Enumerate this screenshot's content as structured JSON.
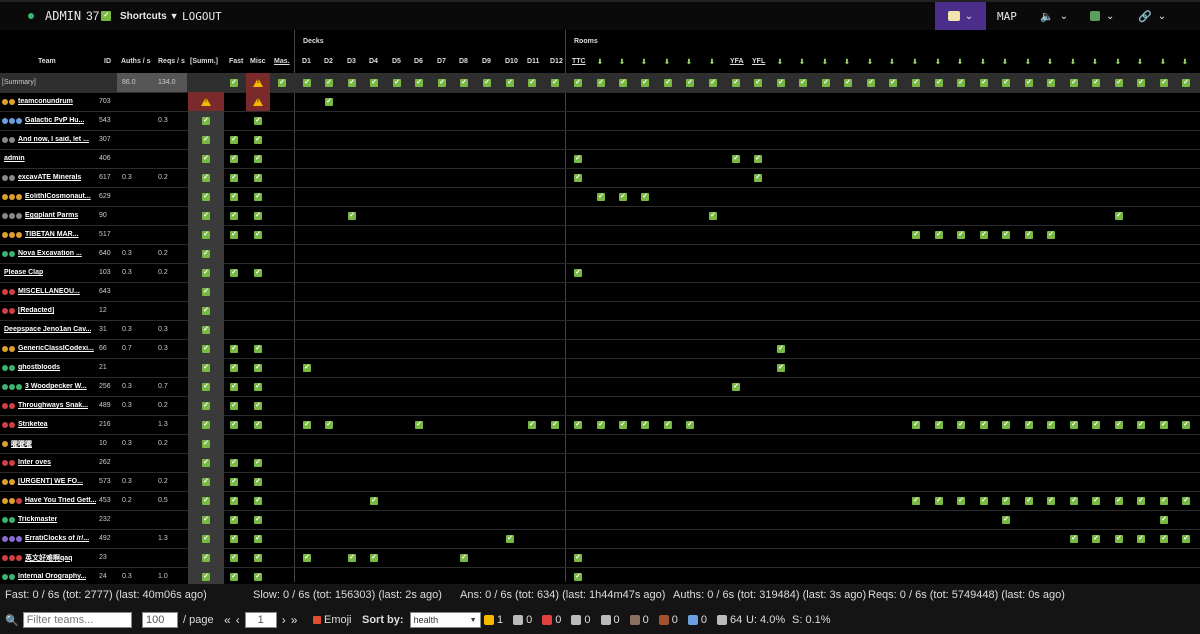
{
  "topbar": {
    "status_icon": "green-dot",
    "admin_label": "ADMIN",
    "count_label": "37",
    "shortcuts_label": "Shortcuts",
    "logout_label": "LOGOUT",
    "map_label": "MAP",
    "accent": "#4a2e8a"
  },
  "table": {
    "team_header": "Team",
    "id_header": "ID",
    "auths_header": "Auths / s",
    "reqs_header": "Reqs / s",
    "summ_header": "[Summ.]",
    "fast_header": "Fast",
    "misc_header": "Misc",
    "mas_header": "Mas.",
    "decks_header": "Decks",
    "rooms_header": "Rooms",
    "decks": [
      "D1",
      "D2",
      "D3",
      "D4",
      "D5",
      "D6",
      "D7",
      "D8",
      "D9",
      "D10",
      "D11",
      "D12"
    ],
    "rooms": [
      "TTC",
      "",
      "",
      "",
      "",
      "",
      "",
      "YFA",
      "YFL",
      "",
      "",
      "",
      "",
      "",
      "",
      "",
      "",
      "",
      "",
      "",
      "",
      "",
      "",
      "",
      "",
      "",
      "",
      ""
    ],
    "summary": {
      "team": "[Summary]",
      "auths": "86.0",
      "reqs": "134.0"
    },
    "rows": [
      {
        "team": "teamconundrum",
        "badges": [
          "#e0a030",
          "#e0a030"
        ],
        "id": "703",
        "auths": "",
        "reqs": "",
        "summ": "warn",
        "fast": "",
        "misc": "warn",
        "decks": [
          2
        ],
        "rooms": []
      },
      {
        "team": "Galactic PvP Hu...",
        "badges": [
          "#6aa0e0",
          "#6aa0e0",
          "#6aa0e0"
        ],
        "id": "543",
        "auths": "",
        "reqs": "0.3",
        "summ": "y",
        "fast": "",
        "misc": "y",
        "decks": [],
        "rooms": []
      },
      {
        "team": "And now, I said, let ...",
        "badges": [
          "#888",
          "#888"
        ],
        "id": "307",
        "auths": "",
        "reqs": "",
        "summ": "y",
        "fast": "y",
        "misc": "y",
        "decks": [],
        "rooms": []
      },
      {
        "team": "admin",
        "badges": [],
        "id": "406",
        "auths": "",
        "reqs": "",
        "summ": "y",
        "fast": "y",
        "misc": "y",
        "decks": [],
        "rooms": [
          1,
          8,
          9
        ]
      },
      {
        "team": "excavATE Minerals",
        "badges": [
          "#888",
          "#888"
        ],
        "id": "617",
        "auths": "0.3",
        "reqs": "0.2",
        "summ": "y",
        "fast": "y",
        "misc": "y",
        "decks": [],
        "rooms": [
          1,
          9
        ]
      },
      {
        "team": "EolithICosmonaut...",
        "badges": [
          "#e0a030",
          "#e0a030",
          "#e0a030"
        ],
        "id": "629",
        "auths": "",
        "reqs": "",
        "summ": "y",
        "fast": "y",
        "misc": "y",
        "decks": [],
        "rooms": [
          2,
          3,
          4
        ]
      },
      {
        "team": "Eggplant Parms",
        "badges": [
          "#888",
          "#888",
          "#888"
        ],
        "id": "90",
        "auths": "",
        "reqs": "",
        "summ": "y",
        "fast": "y",
        "misc": "y",
        "decks": [
          3
        ],
        "rooms": [
          7,
          25
        ]
      },
      {
        "team": "TIBETAN MAR...",
        "badges": [
          "#e0a030",
          "#e0a030",
          "#e0a030"
        ],
        "id": "517",
        "auths": "",
        "reqs": "",
        "summ": "y",
        "fast": "y",
        "misc": "y",
        "decks": [],
        "rooms": [
          16,
          17,
          18,
          19,
          20,
          21,
          22
        ]
      },
      {
        "team": "Nova Excavation ...",
        "badges": [
          "#3cb371",
          "#3cb371"
        ],
        "id": "640",
        "auths": "0.3",
        "reqs": "0.2",
        "summ": "y",
        "fast": "",
        "misc": "",
        "decks": [],
        "rooms": []
      },
      {
        "team": "Please Clap",
        "badges": [],
        "id": "103",
        "auths": "0.3",
        "reqs": "0.2",
        "summ": "y",
        "fast": "y",
        "misc": "y",
        "decks": [],
        "rooms": [
          1
        ]
      },
      {
        "team": "MISCELLANEOU...",
        "badges": [
          "#d04040",
          "#d04040"
        ],
        "id": "643",
        "auths": "",
        "reqs": "",
        "summ": "y",
        "fast": "",
        "misc": "",
        "decks": [],
        "rooms": []
      },
      {
        "team": "[Redacted]",
        "badges": [
          "#d04040",
          "#d04040"
        ],
        "id": "12",
        "auths": "",
        "reqs": "",
        "summ": "y",
        "fast": "",
        "misc": "",
        "decks": [],
        "rooms": []
      },
      {
        "team": "Deepspace Jeno1an Cav...",
        "badges": [],
        "id": "31",
        "auths": "0.3",
        "reqs": "0.3",
        "summ": "y",
        "fast": "",
        "misc": "",
        "decks": [],
        "rooms": []
      },
      {
        "team": "GenericClassICodexi...",
        "badges": [
          "#e0a030",
          "#e0a030"
        ],
        "id": "66",
        "auths": "0.7",
        "reqs": "0.3",
        "summ": "y",
        "fast": "y",
        "misc": "y",
        "decks": [],
        "rooms": [
          10
        ]
      },
      {
        "team": "ghostbloods",
        "badges": [
          "#3cb371",
          "#3cb371"
        ],
        "id": "21",
        "auths": "",
        "reqs": "",
        "summ": "y",
        "fast": "y",
        "misc": "y",
        "decks": [
          1
        ],
        "rooms": [
          10
        ]
      },
      {
        "team": "3 Woodpecker W...",
        "badges": [
          "#3cb371",
          "#3cb371",
          "#3cb371"
        ],
        "id": "256",
        "auths": "0.3",
        "reqs": "0.7",
        "summ": "y",
        "fast": "y",
        "misc": "y",
        "decks": [],
        "rooms": [
          8
        ]
      },
      {
        "team": "Throughways Snak...",
        "badges": [
          "#d04040",
          "#d04040"
        ],
        "id": "489",
        "auths": "0.3",
        "reqs": "0.2",
        "summ": "y",
        "fast": "y",
        "misc": "y",
        "decks": [],
        "rooms": []
      },
      {
        "team": "Striketea",
        "badges": [
          "#d04040",
          "#d04040"
        ],
        "id": "216",
        "auths": "",
        "reqs": "1.3",
        "summ": "y",
        "fast": "y",
        "misc": "y",
        "decks": [
          1,
          2,
          6,
          11,
          12
        ],
        "rooms": [
          1,
          2,
          3,
          4,
          5,
          6,
          16,
          17,
          18,
          19,
          20,
          21,
          22,
          23,
          24,
          25,
          26,
          27,
          28
        ]
      },
      {
        "team": "喔喔喔",
        "badges": [
          "#e0a030"
        ],
        "id": "10",
        "auths": "0.3",
        "reqs": "0.2",
        "summ": "y",
        "fast": "",
        "misc": "",
        "decks": [],
        "rooms": []
      },
      {
        "team": "Inter oves",
        "badges": [
          "#d04040",
          "#d04040"
        ],
        "id": "262",
        "auths": "",
        "reqs": "",
        "summ": "y",
        "fast": "y",
        "misc": "y",
        "decks": [],
        "rooms": []
      },
      {
        "team": "[URGENT] WE FO...",
        "badges": [
          "#e0a030",
          "#e0a030"
        ],
        "id": "573",
        "auths": "0.3",
        "reqs": "0.2",
        "summ": "y",
        "fast": "y",
        "misc": "y",
        "decks": [],
        "rooms": []
      },
      {
        "team": "Have You Tried Gett...",
        "badges": [
          "#e0a030",
          "#e0a030",
          "#d04040"
        ],
        "id": "453",
        "auths": "0.2",
        "reqs": "0.5",
        "summ": "y",
        "fast": "y",
        "misc": "y",
        "decks": [
          4
        ],
        "rooms": [
          16,
          17,
          18,
          19,
          20,
          21,
          22,
          23,
          24,
          25,
          26,
          27,
          28
        ]
      },
      {
        "team": "Trickmaster",
        "badges": [
          "#3cb371",
          "#3cb371"
        ],
        "id": "232",
        "auths": "",
        "reqs": "",
        "summ": "y",
        "fast": "y",
        "misc": "y",
        "decks": [],
        "rooms": [
          20,
          27
        ]
      },
      {
        "team": "ErratiClocks of /r/...",
        "badges": [
          "#8a6ad0",
          "#8a6ad0",
          "#8a6ad0"
        ],
        "id": "492",
        "auths": "",
        "reqs": "1.3",
        "summ": "y",
        "fast": "y",
        "misc": "y",
        "decks": [
          10
        ],
        "rooms": [
          23,
          24,
          25,
          26,
          27,
          28
        ]
      },
      {
        "team": "英文好难啊qaq",
        "badges": [
          "#d04040",
          "#d04040",
          "#d04040"
        ],
        "id": "23",
        "auths": "",
        "reqs": "",
        "summ": "y",
        "fast": "y",
        "misc": "y",
        "decks": [
          1,
          3,
          4,
          8
        ],
        "rooms": [
          1
        ]
      },
      {
        "team": "Internal Orography...",
        "badges": [
          "#3cb371",
          "#3cb371"
        ],
        "id": "24",
        "auths": "0.3",
        "reqs": "1.0",
        "summ": "y",
        "fast": "y",
        "misc": "y",
        "decks": [],
        "rooms": [
          1
        ]
      }
    ]
  },
  "stats": {
    "fast": "Fast: 0 / 6s (tot: 2777) (last: 40m06s ago)",
    "slow": "Slow: 0 / 6s (tot: 156303) (last: 2s ago)",
    "ans": "Ans: 0 / 6s (tot: 634) (last: 1h44m47s ago)",
    "auths": "Auths: 0 / 6s (tot: 319484) (last: 3s ago)",
    "reqs": "Reqs: 0 / 6s (tot: 5749448) (last: 0s ago)"
  },
  "bottom": {
    "filter_placeholder": "Filter teams...",
    "per_page_value": "100",
    "per_page_label": "/ page",
    "page_value": "1",
    "emoji_label": "Emoji",
    "sortby_label": "Sort by:",
    "sortby_value": "health",
    "counters": [
      {
        "icon": "warning-icon",
        "color": "#f5b700",
        "value": "1"
      },
      {
        "icon": "hourglass-icon",
        "color": "#bbb",
        "value": "0"
      },
      {
        "icon": "star-icon",
        "color": "#e04040",
        "value": "0"
      },
      {
        "icon": "rabbit-icon",
        "color": "#bbb",
        "value": "0"
      },
      {
        "icon": "stopwatch-icon",
        "color": "#bbb",
        "value": "0"
      },
      {
        "icon": "phone-icon",
        "color": "#8a7060",
        "value": "0"
      },
      {
        "icon": "door-icon",
        "color": "#a0522d",
        "value": "0"
      },
      {
        "icon": "users-icon",
        "color": "#6aa0e0",
        "value": "0"
      },
      {
        "icon": "pen-icon",
        "color": "#bbb",
        "value": "64"
      }
    ],
    "u_label": "U: 4.0%",
    "s_label": "S: 0.1%"
  }
}
